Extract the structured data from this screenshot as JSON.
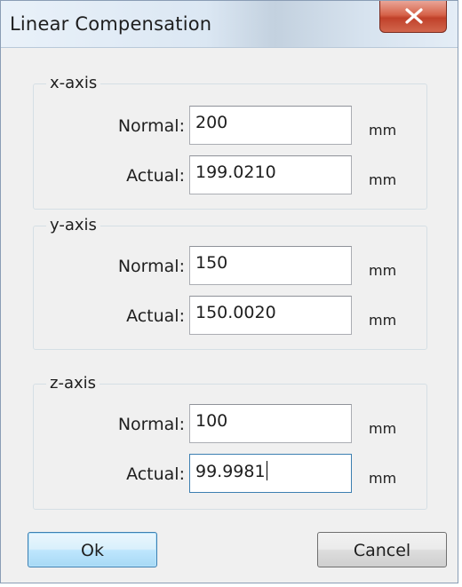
{
  "window": {
    "title": "Linear Compensation",
    "close_glyph": "X"
  },
  "groups": [
    {
      "legend": "x-axis",
      "rows": [
        {
          "label": "Normal:",
          "value": "200",
          "unit": "mm"
        },
        {
          "label": "Actual:",
          "value": "199.0210",
          "unit": "mm"
        }
      ]
    },
    {
      "legend": "y-axis",
      "rows": [
        {
          "label": "Normal:",
          "value": "150",
          "unit": "mm"
        },
        {
          "label": "Actual:",
          "value": "150.0020",
          "unit": "mm"
        }
      ]
    },
    {
      "legend": "z-axis",
      "rows": [
        {
          "label": "Normal:",
          "value": "100",
          "unit": "mm"
        },
        {
          "label": "Actual:",
          "value": "99.9981",
          "unit": "mm"
        }
      ]
    }
  ],
  "buttons": {
    "ok": "Ok",
    "cancel": "Cancel"
  },
  "icons": {
    "close": "close-icon"
  },
  "colors": {
    "close_button": "#c8432c",
    "focus_border": "#3c7fb1"
  }
}
